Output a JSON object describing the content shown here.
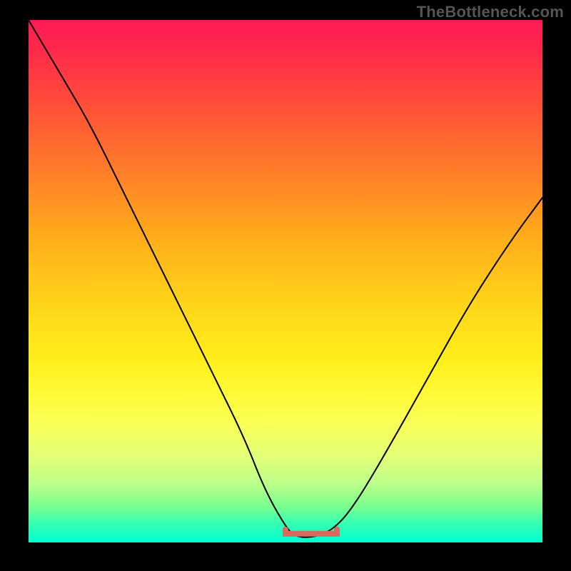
{
  "watermark": "TheBottleneck.com",
  "colors": {
    "gradient_top": "#ff1a56",
    "gradient_bottom": "#00ffd0",
    "curve": "#000000",
    "marker": "#d66a5c",
    "frame": "#000000"
  },
  "chart_data": {
    "type": "line",
    "title": "",
    "xlabel": "",
    "ylabel": "",
    "xlim": [
      0,
      100
    ],
    "ylim": [
      0,
      100
    ],
    "grid": false,
    "legend": false,
    "annotations": [
      {
        "text": "TheBottleneck.com",
        "position": "top-right"
      }
    ],
    "series": [
      {
        "name": "bottleneck-curve",
        "x": [
          0,
          6,
          12,
          18,
          24,
          30,
          36,
          42,
          46,
          50,
          52,
          56,
          60,
          64,
          70,
          78,
          86,
          94,
          100
        ],
        "values": [
          100,
          90,
          80,
          68,
          56,
          44,
          32,
          20,
          10,
          3,
          1,
          1,
          3,
          8,
          18,
          32,
          46,
          58,
          66
        ]
      }
    ],
    "highlight": {
      "name": "recommended-range",
      "x": [
        50,
        60
      ],
      "y": [
        1,
        1
      ]
    }
  }
}
